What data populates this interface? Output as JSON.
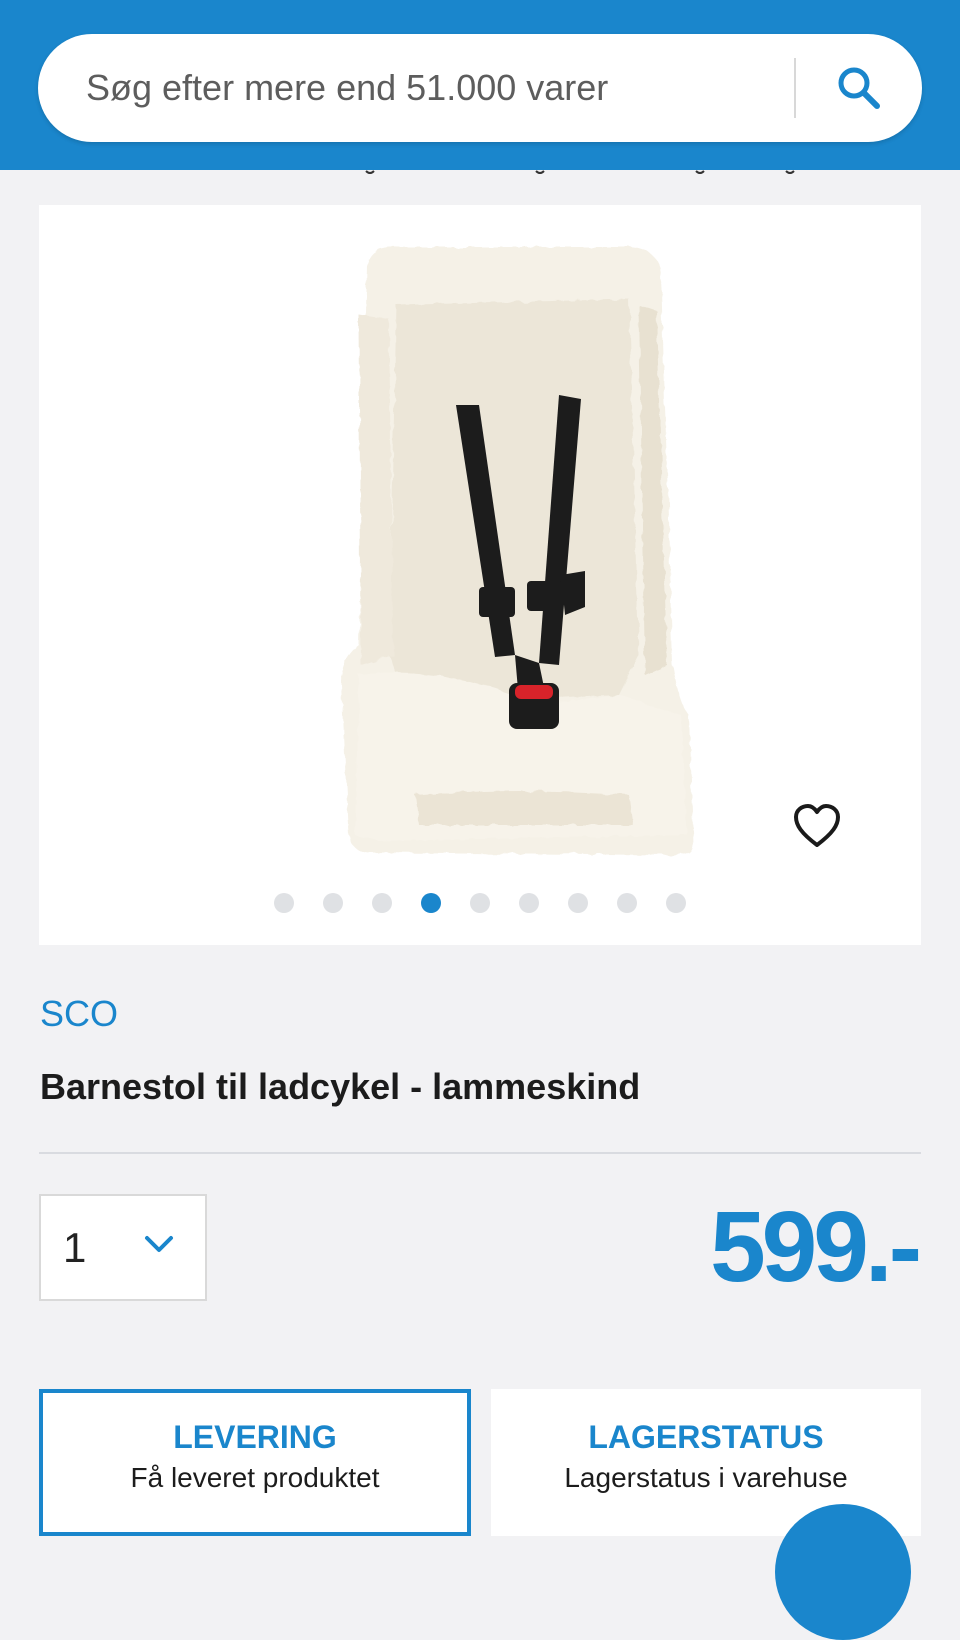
{
  "search": {
    "placeholder": "Søg efter mere end 51.000 varer",
    "icon": "search-icon"
  },
  "gallery": {
    "image_count": 9,
    "active_index": 3,
    "favorite_icon": "heart-icon"
  },
  "product": {
    "brand": "SCO",
    "title": "Barnestol til ladcykel - lammeskind",
    "price": "599.-"
  },
  "quantity": {
    "value": "1",
    "icon": "chevron-down-icon"
  },
  "panels": {
    "delivery": {
      "title": "LEVERING",
      "subtitle": "Få leveret produktet"
    },
    "stock": {
      "title": "LAGERSTATUS",
      "subtitle": "Lagerstatus i varehuse"
    }
  },
  "colors": {
    "brand_blue": "#1a86cc",
    "background": "#f2f2f4"
  }
}
